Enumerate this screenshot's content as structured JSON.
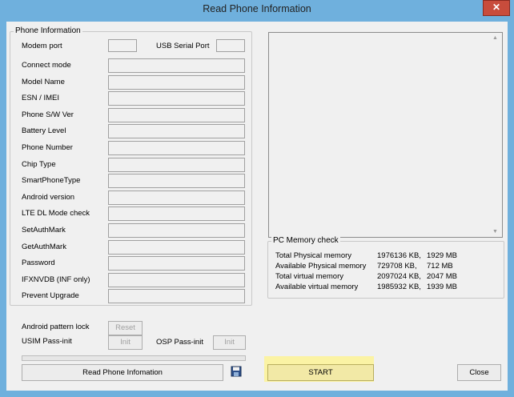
{
  "window": {
    "title": "Read Phone Information",
    "close_glyph": "✕"
  },
  "phone_info": {
    "legend": "Phone Information",
    "rows": [
      {
        "label": "Connect mode"
      },
      {
        "label": "Model Name"
      },
      {
        "label": "ESN / IMEI"
      },
      {
        "label": "Phone S/W Ver"
      },
      {
        "label": "Battery Level"
      },
      {
        "label": "Phone Number"
      },
      {
        "label": "Chip Type"
      },
      {
        "label": "SmartPhoneType"
      },
      {
        "label": "Android version"
      },
      {
        "label": "LTE DL Mode check"
      },
      {
        "label": "SetAuthMark"
      },
      {
        "label": "GetAuthMark"
      },
      {
        "label": "Password"
      },
      {
        "label": "IFXNVDB (INF only)"
      },
      {
        "label": "Prevent Upgrade"
      }
    ],
    "modem_port_label": "Modem port",
    "usb_serial_port_label": "USB Serial Port",
    "android_pattern_lock_label": "Android pattern lock",
    "reset_label": "Reset",
    "usim_pass_init_label": "USIM Pass-init",
    "usim_init_label": "Init",
    "osp_pass_init_label": "OSP Pass-init",
    "osp_init_label": "Init",
    "read_button_label": "Read Phone Infomation"
  },
  "memory": {
    "legend": "PC Memory check",
    "rows": [
      {
        "label": "Total Physical memory",
        "kb": "1976136 KB,",
        "mb": "1929 MB"
      },
      {
        "label": "Available Physical memory",
        "kb": "729708 KB,",
        "mb": "712 MB"
      },
      {
        "label": "Total virtual memory",
        "kb": "2097024 KB,",
        "mb": "2047 MB"
      },
      {
        "label": "Available virtual memory",
        "kb": "1985932 KB,",
        "mb": "1939 MB"
      }
    ]
  },
  "actions": {
    "start_label": "START",
    "close_label": "Close"
  },
  "colors": {
    "start_highlight": "#fbf3a4",
    "title_bar": "#6fb0dd"
  },
  "icons": {
    "save": "floppy-disk-icon",
    "close": "close-icon",
    "scroll_up": "scroll-up-arrow-icon",
    "scroll_down": "scroll-down-arrow-icon"
  }
}
